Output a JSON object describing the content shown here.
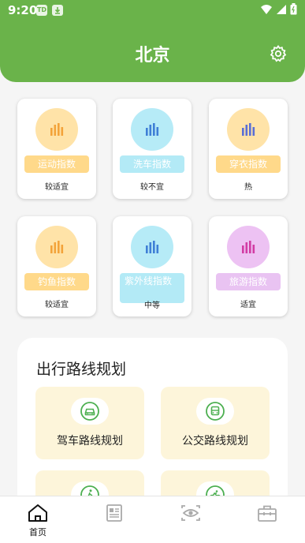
{
  "status_bar": {
    "time": "9:20",
    "notif_badge": "TD"
  },
  "header": {
    "city": "北京"
  },
  "indices": [
    {
      "name": "运动指数",
      "value": "较适宜",
      "circle_color": "#ffe3a8",
      "pill_color": "#ffd98a",
      "bar_color": "#f3a33a"
    },
    {
      "name": "洗车指数",
      "value": "较不宜",
      "circle_color": "#b6ebf7",
      "pill_color": "#b3eaf6",
      "bar_color": "#3f7fd6"
    },
    {
      "name": "穿衣指数",
      "value": "热",
      "circle_color": "#ffe3a8",
      "pill_color": "#ffd98a",
      "bar_color": "#5a6fd6"
    },
    {
      "name": "钓鱼指数",
      "value": "较适宜",
      "circle_color": "#ffe3a8",
      "pill_color": "#ffd98a",
      "bar_color": "#f3a33a"
    },
    {
      "name": "紫外线指数",
      "value": "中等",
      "circle_color": "#b6ebf7",
      "pill_color": "#b3eaf6",
      "bar_color": "#3f7fd6"
    },
    {
      "name": "旅游指数",
      "value": "适宜",
      "circle_color": "#edc2f3",
      "pill_color": "#e9c3f2",
      "bar_color": "#d23ca4"
    }
  ],
  "route": {
    "title": "出行路线规划",
    "tiles": [
      {
        "label": "驾车路线规划",
        "icon": "car-icon"
      },
      {
        "label": "公交路线规划",
        "icon": "bus-icon"
      },
      {
        "label": "",
        "icon": "walk-icon"
      },
      {
        "label": "",
        "icon": "bike-icon"
      }
    ]
  },
  "tabbar": [
    {
      "label": "首页",
      "icon": "home-icon",
      "active": true
    },
    {
      "label": "",
      "icon": "news-icon",
      "active": false
    },
    {
      "label": "",
      "icon": "eye-icon",
      "active": false
    },
    {
      "label": "",
      "icon": "toolbox-icon",
      "active": false
    }
  ],
  "colors": {
    "brand_green": "#6ab34a",
    "tile_bg": "#fdf5da",
    "icon_green": "#4caf50"
  }
}
